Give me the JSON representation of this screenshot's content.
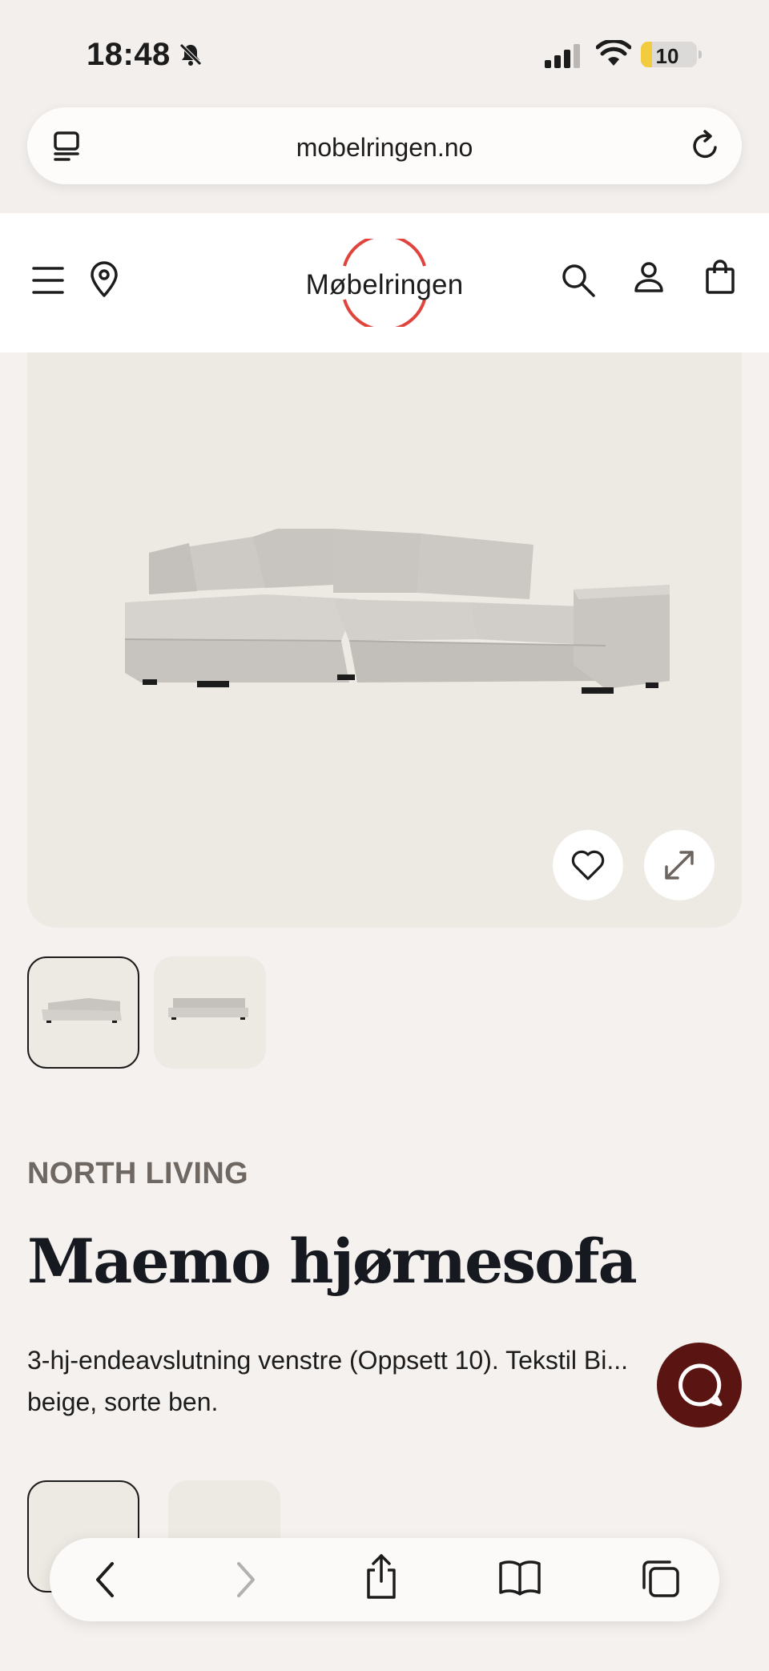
{
  "status_bar": {
    "time": "18:48",
    "battery_level": "10",
    "icons": [
      "bell-slash-icon",
      "signal-icon",
      "wifi-icon",
      "battery-icon"
    ]
  },
  "browser": {
    "url": "mobelringen.no",
    "icons": [
      "tabs-icon",
      "reload-icon"
    ]
  },
  "header": {
    "logo_text": "Møbelringen",
    "logo_color": "#e0443c",
    "icons": [
      "menu-icon",
      "location-pin-icon",
      "search-icon",
      "user-icon",
      "shopping-bag-icon"
    ]
  },
  "product": {
    "brand": "NORTH LIVING",
    "title": "Maemo hjørnesofa",
    "description": "3-hj-endeavslutning venstre (Oppsett 10). Tekstil Bi... beige, sorte ben.",
    "image_icons": [
      "heart-icon",
      "expand-icon"
    ],
    "thumbnails": [
      "thumb-angle-view",
      "thumb-front-view"
    ]
  },
  "chat": {
    "color": "#5a1512",
    "icon": "chat-icon"
  },
  "toolbar": {
    "icons": [
      "back-icon",
      "forward-icon",
      "share-icon",
      "bookmarks-icon",
      "tabs-overview-icon"
    ]
  }
}
